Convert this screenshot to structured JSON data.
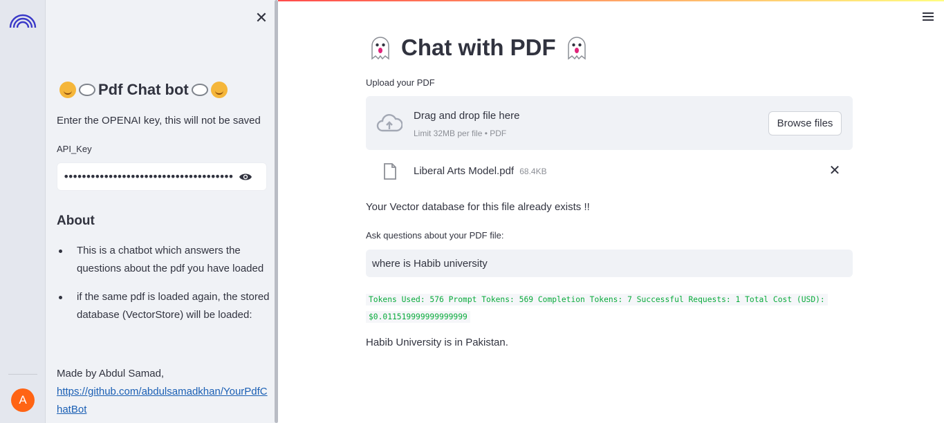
{
  "sidebar": {
    "title": "Pdf Chat bot",
    "description": "Enter the OPENAI key, this will not be saved",
    "api_key_label": "API_Key",
    "api_key_value": "••••••••••••••••••••••••••••••••••••••••••••••••••",
    "about_heading": "About",
    "about_items": [
      "This is a chatbot which answers the questions about the pdf you have loaded",
      "if the same pdf is loaded again, the stored database (VectorStore) will be loaded:"
    ],
    "made_by": "Made by Abdul Samad,",
    "link": "https://github.com/abdulsamadkhan/YourPdfChatBot"
  },
  "rail": {
    "avatar_letter": "A"
  },
  "main": {
    "title": "Chat with PDF",
    "upload_label": "Upload your PDF",
    "dropzone_title": "Drag and drop file here",
    "dropzone_limit": "Limit 32MB per file • PDF",
    "browse_label": "Browse files",
    "file_name": "Liberal Arts Model.pdf",
    "file_size": "68.4KB",
    "status": "Your Vector database for this file already exists !!",
    "question_label": "Ask questions about your PDF file:",
    "question_value": "where is Habib university",
    "tokens_line1": "Tokens Used: 576 Prompt Tokens: 569 Completion Tokens: 7 Successful Requests: 1 Total Cost (USD):",
    "tokens_line2": "$0.011519999999999999",
    "answer": "Habib University is in Pakistan."
  },
  "colors": {
    "accent": "#ff4b4b",
    "tokens_text": "#09ab3b",
    "avatar": "#ff6414",
    "logo": "#3a39c8"
  },
  "icons": {
    "logo": "rainbow-logo-icon",
    "close": "close-icon",
    "eye": "eye-icon",
    "menu": "hamburger-menu-icon",
    "cloud": "cloud-upload-icon",
    "file": "file-icon",
    "remove": "close-icon",
    "ghost": "ghost-icon",
    "hug": "hugging-face-icon",
    "bubble": "speech-bubble-icon"
  }
}
